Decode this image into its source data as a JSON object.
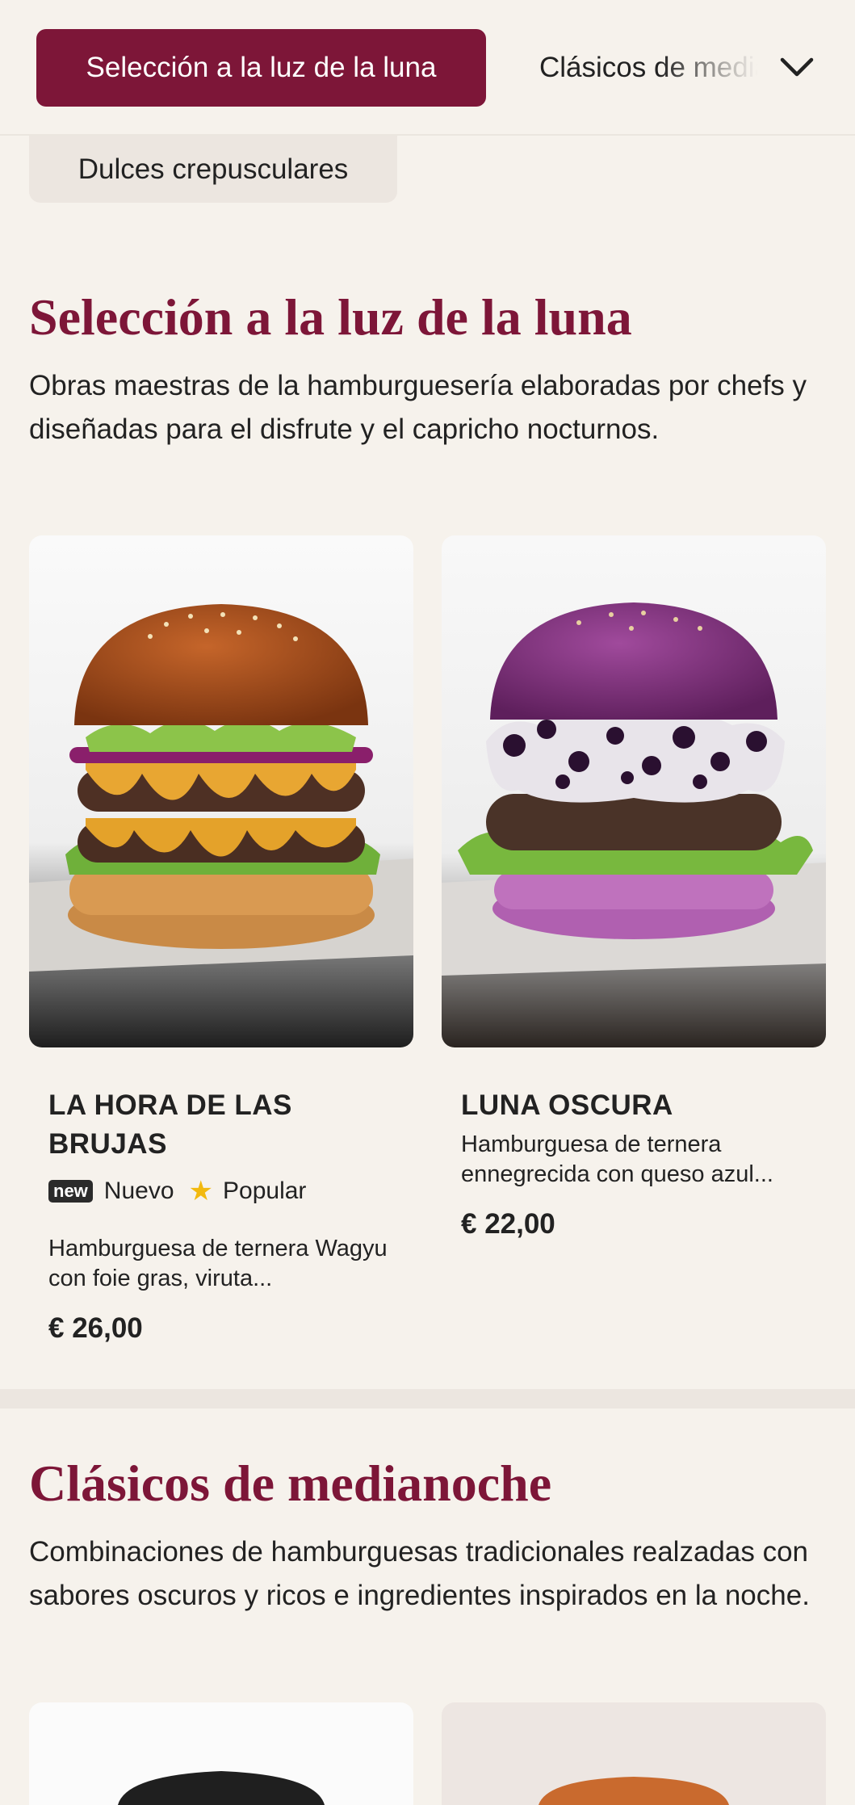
{
  "nav": {
    "active_category": "Selección a la luz de la luna",
    "next_category": "Clásicos de medianoche",
    "sub_category": "Dulces crepusculares"
  },
  "sections": [
    {
      "title": "Selección a la luz de la luna",
      "description": "Obras maestras de la hamburguesería elaboradas por chefs y diseñadas para el disfrute y el capricho nocturnos.",
      "items": [
        {
          "name": "LA HORA DE LAS BRUJAS",
          "badge_new": "new",
          "badge_new_label": "Nuevo",
          "badge_popular_label": "Popular",
          "description": "Hamburguesa de ternera Wagyu con foie gras, viruta...",
          "price": "€ 26,00"
        },
        {
          "name": "LUNA OSCURA",
          "description": "Hamburguesa de ternera ennegrecida con queso azul...",
          "price": "€ 22,00"
        }
      ]
    },
    {
      "title": "Clásicos de medianoche",
      "description": "Combinaciones de hamburguesas tradicionales realzadas con sabores oscuros y ricos e ingredientes inspirados en la noche."
    }
  ],
  "colors": {
    "accent": "#7d1638",
    "background": "#f6f2ec",
    "star": "#f2b90f"
  }
}
